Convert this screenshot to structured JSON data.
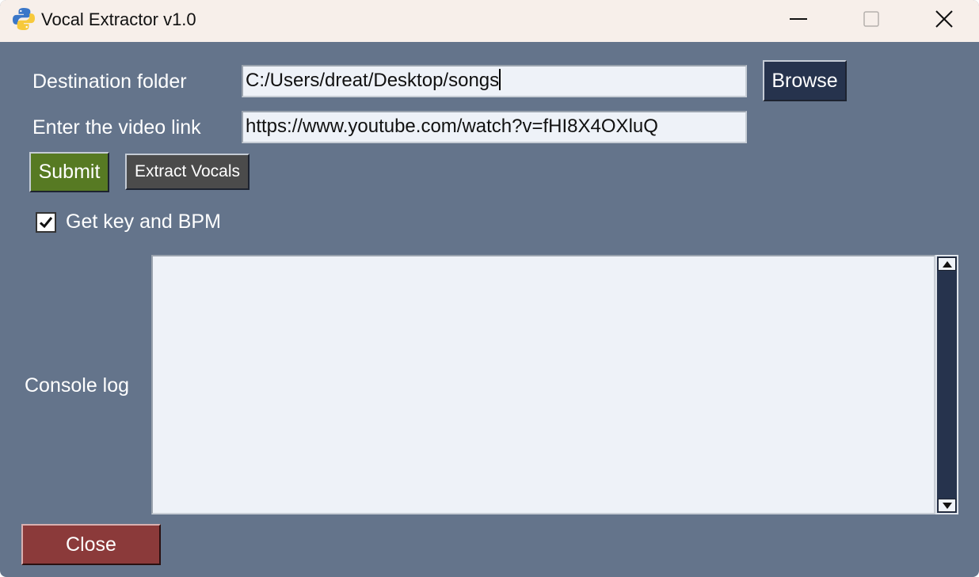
{
  "window": {
    "title": "Vocal Extractor v1.0",
    "icon": "python-icon"
  },
  "form": {
    "destination_label": "Destination folder",
    "destination_value": "C:/Users/dreat/Desktop/songs",
    "browse_label": "Browse",
    "link_label": "Enter the video link",
    "link_value": "https://www.youtube.com/watch?v=fHI8X4OXluQ",
    "submit_label": "Submit",
    "extract_label": "Extract Vocals",
    "checkbox_label": "Get key and BPM",
    "checkbox_checked": true
  },
  "console": {
    "label": "Console log",
    "content": ""
  },
  "footer": {
    "close_label": "Close"
  },
  "colors": {
    "background": "#64748b",
    "titlebar": "#f7efea",
    "browse": "#26334d",
    "submit": "#577a23",
    "extract": "#4b4b4b",
    "close": "#8b3a3a"
  }
}
